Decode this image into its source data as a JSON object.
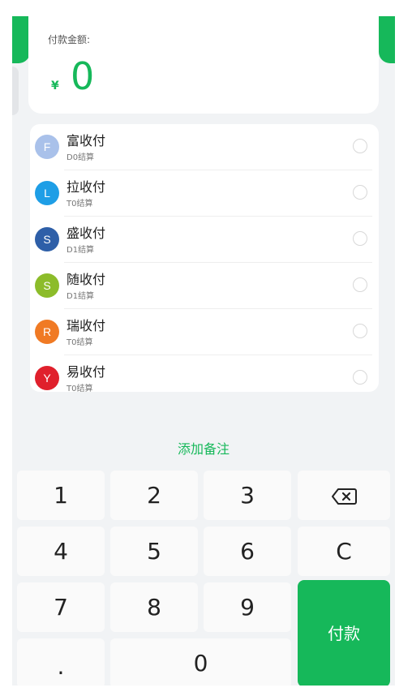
{
  "amount": {
    "label": "付款金额:",
    "currency": "¥",
    "value": "0"
  },
  "channels": [
    {
      "letter": "F",
      "name": "富收付",
      "settle": "D0结算",
      "color": "#a9c1ea"
    },
    {
      "letter": "L",
      "name": "拉收付",
      "settle": "T0结算",
      "color": "#1e9ee6"
    },
    {
      "letter": "S",
      "name": "盛收付",
      "settle": "D1结算",
      "color": "#2e5fa8"
    },
    {
      "letter": "S",
      "name": "随收付",
      "settle": "D1结算",
      "color": "#8cbc2a"
    },
    {
      "letter": "R",
      "name": "瑞收付",
      "settle": "T0结算",
      "color": "#f07a24"
    },
    {
      "letter": "Y",
      "name": "易收付",
      "settle": "T0结算",
      "color": "#e0202c"
    }
  ],
  "remark_link": "添加备注",
  "keypad": {
    "k1": "1",
    "k2": "2",
    "k3": "3",
    "k4": "4",
    "k5": "5",
    "k6": "6",
    "k7": "7",
    "k8": "8",
    "k9": "9",
    "dot": ".",
    "k0": "0",
    "clear": "C",
    "pay": "付款",
    "backspace_icon": "backspace-icon"
  },
  "colors": {
    "accent": "#16b85a"
  }
}
